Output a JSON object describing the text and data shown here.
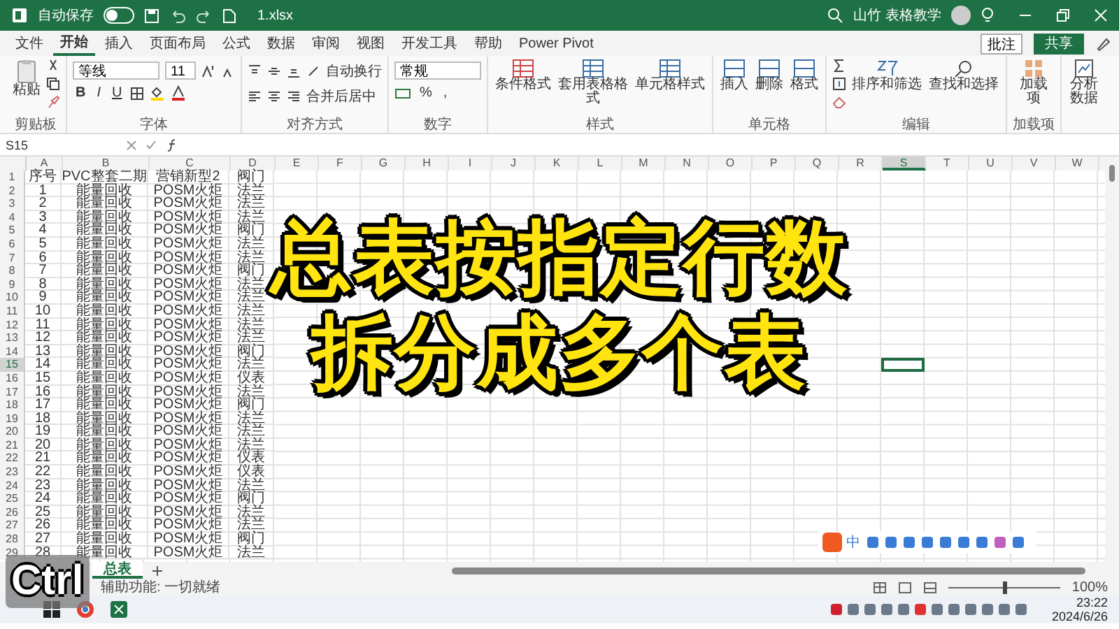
{
  "window": {
    "autosave_label": "自动保存",
    "autosave_on": false,
    "filename": "1.xlsx",
    "user": "山竹 表格教学"
  },
  "tabs": [
    {
      "label": "文件",
      "selected": false
    },
    {
      "label": "开始",
      "selected": true
    },
    {
      "label": "插入",
      "selected": false
    },
    {
      "label": "页面布局",
      "selected": false
    },
    {
      "label": "公式",
      "selected": false
    },
    {
      "label": "数据",
      "selected": false
    },
    {
      "label": "审阅",
      "selected": false
    },
    {
      "label": "视图",
      "selected": false
    },
    {
      "label": "开发工具",
      "selected": false
    },
    {
      "label": "帮助",
      "selected": false
    },
    {
      "label": "Power Pivot",
      "selected": false
    }
  ],
  "actions": {
    "comment": "批注",
    "share": "共享"
  },
  "ribbon": {
    "clipboard": {
      "paste": "粘贴",
      "label": "剪贴板"
    },
    "font": {
      "name": "等线",
      "size": "11",
      "buttons": [
        "B",
        "I",
        "U"
      ],
      "label": "字体"
    },
    "alignment": {
      "wrap": "自动换行",
      "merge": "合并后居中",
      "label": "对齐方式"
    },
    "number": {
      "format": "常规",
      "symbols": [
        "%",
        ","
      ],
      "label": "数字"
    },
    "styles": {
      "buttons": [
        "条件格式",
        "套用表格格式",
        "单元格样式"
      ],
      "label": "样式"
    },
    "cells": {
      "buttons": [
        "插入",
        "删除",
        "格式"
      ],
      "label": "单元格"
    },
    "editing": {
      "buttons": [
        "排序和筛选",
        "查找和选择"
      ],
      "label": "编辑"
    },
    "addins": {
      "button": "加载项",
      "label": "加载项"
    },
    "analyze": {
      "button": "分析数据"
    }
  },
  "formula_bar": {
    "name_box": "S15"
  },
  "columns": [
    {
      "label": "A",
      "selected": false
    },
    {
      "label": "B",
      "selected": false
    },
    {
      "label": "C",
      "selected": false
    },
    {
      "label": "D",
      "selected": false
    },
    {
      "label": "E",
      "selected": false
    },
    {
      "label": "F",
      "selected": false
    },
    {
      "label": "G",
      "selected": false
    },
    {
      "label": "H",
      "selected": false
    },
    {
      "label": "I",
      "selected": false
    },
    {
      "label": "J",
      "selected": false
    },
    {
      "label": "K",
      "selected": false
    },
    {
      "label": "L",
      "selected": false
    },
    {
      "label": "M",
      "selected": false
    },
    {
      "label": "N",
      "selected": false
    },
    {
      "label": "O",
      "selected": false
    },
    {
      "label": "P",
      "selected": false
    },
    {
      "label": "Q",
      "selected": false
    },
    {
      "label": "R",
      "selected": false
    },
    {
      "label": "S",
      "selected": true
    },
    {
      "label": "T",
      "selected": false
    },
    {
      "label": "U",
      "selected": false
    },
    {
      "label": "V",
      "selected": false
    },
    {
      "label": "W",
      "selected": false
    }
  ],
  "rows": [
    {
      "number": "1",
      "selected": false,
      "cells": [
        "序号",
        "PVC整套二期",
        "营销新型2",
        "阀门"
      ]
    },
    {
      "number": "2",
      "selected": false,
      "cells": [
        "1",
        "能量回收",
        "POSM火炬",
        "法兰"
      ]
    },
    {
      "number": "3",
      "selected": false,
      "cells": [
        "2",
        "能量回收",
        "POSM火炬",
        "法兰"
      ]
    },
    {
      "number": "4",
      "selected": false,
      "cells": [
        "3",
        "能量回收",
        "POSM火炬",
        "法兰"
      ]
    },
    {
      "number": "5",
      "selected": false,
      "cells": [
        "4",
        "能量回收",
        "POSM火炬",
        "阀门"
      ]
    },
    {
      "number": "6",
      "selected": false,
      "cells": [
        "5",
        "能量回收",
        "POSM火炬",
        "法兰"
      ]
    },
    {
      "number": "7",
      "selected": false,
      "cells": [
        "6",
        "能量回收",
        "POSM火炬",
        "法兰"
      ]
    },
    {
      "number": "8",
      "selected": false,
      "cells": [
        "7",
        "能量回收",
        "POSM火炬",
        "阀门"
      ]
    },
    {
      "number": "9",
      "selected": false,
      "cells": [
        "8",
        "能量回收",
        "POSM火炬",
        "法兰"
      ]
    },
    {
      "number": "10",
      "selected": false,
      "cells": [
        "9",
        "能量回收",
        "POSM火炬",
        "法兰"
      ]
    },
    {
      "number": "11",
      "selected": false,
      "cells": [
        "10",
        "能量回收",
        "POSM火炬",
        "法兰"
      ]
    },
    {
      "number": "12",
      "selected": false,
      "cells": [
        "11",
        "能量回收",
        "POSM火炬",
        "法兰"
      ]
    },
    {
      "number": "13",
      "selected": false,
      "cells": [
        "12",
        "能量回收",
        "POSM火炬",
        "法兰"
      ]
    },
    {
      "number": "14",
      "selected": false,
      "cells": [
        "13",
        "能量回收",
        "POSM火炬",
        "阀门"
      ]
    },
    {
      "number": "15",
      "selected": true,
      "cells": [
        "14",
        "能量回收",
        "POSM火炬",
        "法兰"
      ]
    },
    {
      "number": "16",
      "selected": false,
      "cells": [
        "15",
        "能量回收",
        "POSM火炬",
        "仪表"
      ]
    },
    {
      "number": "17",
      "selected": false,
      "cells": [
        "16",
        "能量回收",
        "POSM火炬",
        "法兰"
      ]
    },
    {
      "number": "18",
      "selected": false,
      "cells": [
        "17",
        "能量回收",
        "POSM火炬",
        "阀门"
      ]
    },
    {
      "number": "19",
      "selected": false,
      "cells": [
        "18",
        "能量回收",
        "POSM火炬",
        "法兰"
      ]
    },
    {
      "number": "20",
      "selected": false,
      "cells": [
        "19",
        "能量回收",
        "POSM火炬",
        "法兰"
      ]
    },
    {
      "number": "21",
      "selected": false,
      "cells": [
        "20",
        "能量回收",
        "POSM火炬",
        "法兰"
      ]
    },
    {
      "number": "22",
      "selected": false,
      "cells": [
        "21",
        "能量回收",
        "POSM火炬",
        "仪表"
      ]
    },
    {
      "number": "23",
      "selected": false,
      "cells": [
        "22",
        "能量回收",
        "POSM火炬",
        "仪表"
      ]
    },
    {
      "number": "24",
      "selected": false,
      "cells": [
        "23",
        "能量回收",
        "POSM火炬",
        "法兰"
      ]
    },
    {
      "number": "25",
      "selected": false,
      "cells": [
        "24",
        "能量回收",
        "POSM火炬",
        "阀门"
      ]
    },
    {
      "number": "26",
      "selected": false,
      "cells": [
        "25",
        "能量回收",
        "POSM火炬",
        "法兰"
      ]
    },
    {
      "number": "27",
      "selected": false,
      "cells": [
        "26",
        "能量回收",
        "POSM火炬",
        "法兰"
      ]
    },
    {
      "number": "28",
      "selected": false,
      "cells": [
        "27",
        "能量回收",
        "POSM火炬",
        "阀门"
      ]
    },
    {
      "number": "29",
      "selected": false,
      "cells": [
        "28",
        "能量回收",
        "POSM火炬",
        "法兰"
      ]
    }
  ],
  "title_overlay": [
    "总表按指定行数",
    "拆分成多个表"
  ],
  "key_overlay": "Ctrl",
  "ime": {
    "mode": "中"
  },
  "sheet_tabs": [
    {
      "label": "总表",
      "selected": true
    }
  ],
  "status_bar": {
    "text": "辅助功能: 一切就绪",
    "zoom": {
      "label": "100%",
      "level": 0.5
    }
  },
  "taskbar": {
    "time": "23:22",
    "date": "2024/6/26"
  }
}
